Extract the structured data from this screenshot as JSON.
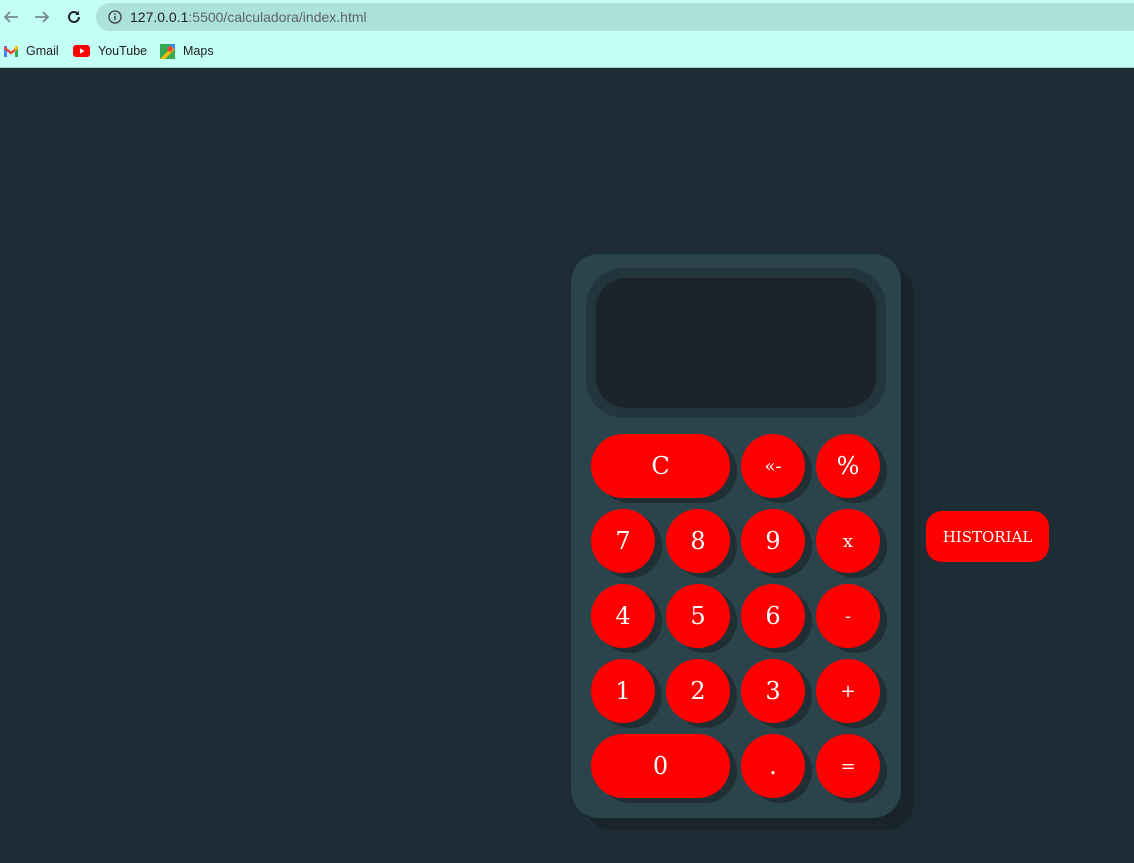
{
  "browser": {
    "url_host": "127.0.0.1",
    "url_path": ":5500/calculadora/index.html",
    "bookmarks": [
      {
        "label": "Gmail",
        "icon": "gmail-icon"
      },
      {
        "label": "YouTube",
        "icon": "youtube-icon"
      },
      {
        "label": "Maps",
        "icon": "maps-icon"
      }
    ]
  },
  "calculator": {
    "display": "",
    "keys": {
      "clear": "C",
      "backspace": "«-",
      "percent": "%",
      "seven": "7",
      "eight": "8",
      "nine": "9",
      "multiply": "x",
      "four": "4",
      "five": "5",
      "six": "6",
      "minus": "-",
      "one": "1",
      "two": "2",
      "three": "3",
      "plus": "+",
      "zero": "0",
      "dot": ".",
      "equals": "="
    },
    "accent_color": "#ff0000",
    "body_color": "#2b444b"
  },
  "historial_label": "HISTORIAL"
}
